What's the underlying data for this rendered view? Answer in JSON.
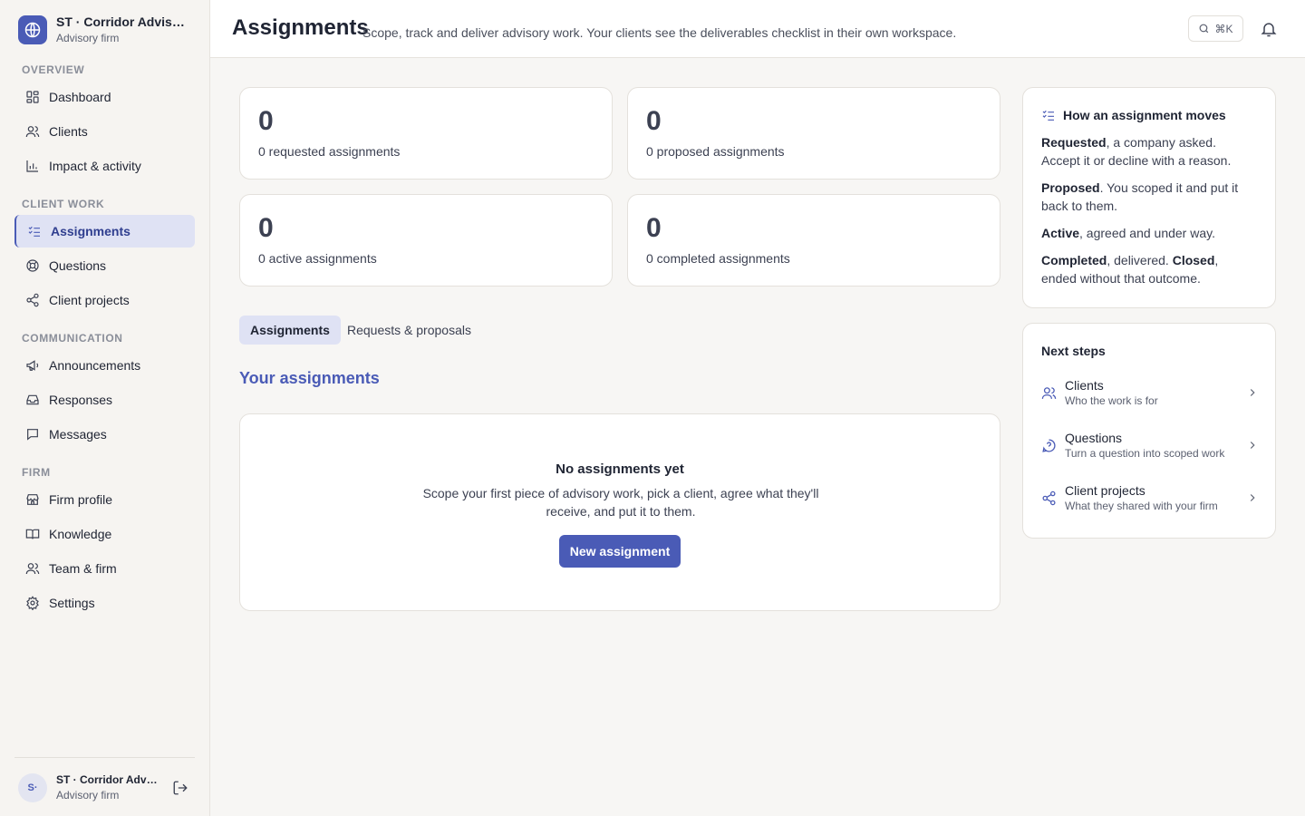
{
  "org": {
    "name": "ST · Corridor Advisory...",
    "type": "Advisory firm"
  },
  "sidebar": {
    "sections": [
      {
        "label": "OVERVIEW"
      },
      {
        "label": "CLIENT WORK"
      },
      {
        "label": "COMMUNICATION"
      },
      {
        "label": "FIRM"
      }
    ],
    "items": [
      {
        "label": "Dashboard",
        "icon": "grid-icon"
      },
      {
        "label": "Clients",
        "icon": "users-icon"
      },
      {
        "label": "Impact & activity",
        "icon": "bar-chart-icon"
      },
      {
        "label": "Assignments",
        "icon": "checklist-icon",
        "active": true
      },
      {
        "label": "Questions",
        "icon": "lifebuoy-icon"
      },
      {
        "label": "Client projects",
        "icon": "share-icon"
      },
      {
        "label": "Announcements",
        "icon": "megaphone-icon"
      },
      {
        "label": "Responses",
        "icon": "inbox-icon"
      },
      {
        "label": "Messages",
        "icon": "message-icon"
      },
      {
        "label": "Firm profile",
        "icon": "store-icon"
      },
      {
        "label": "Knowledge",
        "icon": "book-icon"
      },
      {
        "label": "Team & firm",
        "icon": "users-icon"
      },
      {
        "label": "Settings",
        "icon": "gear-icon"
      }
    ]
  },
  "user": {
    "initials": "S·",
    "name": "ST · Corridor Advis...",
    "role": "Advisory firm"
  },
  "header": {
    "title": "Assignments",
    "subtitle": "Scope, track and deliver advisory work. Your clients see the deliverables checklist in their own workspace.",
    "search_shortcut": "⌘K"
  },
  "stats": [
    {
      "value": "0",
      "label": "0 requested assignments"
    },
    {
      "value": "0",
      "label": "0 proposed assignments"
    },
    {
      "value": "0",
      "label": "0 active assignments"
    },
    {
      "value": "0",
      "label": "0 completed assignments"
    }
  ],
  "tabs": [
    {
      "label": "Assignments",
      "active": true
    },
    {
      "label": "Requests & proposals",
      "active": false
    }
  ],
  "section_title": "Your assignments",
  "empty": {
    "title": "No assignments yet",
    "description": "Scope your first piece of advisory work, pick a client, agree what they'll receive, and put it to them.",
    "button": "New assignment"
  },
  "how_panel": {
    "title": "How an assignment moves",
    "rules": [
      {
        "term": "Requested",
        "text": ", a company asked. Accept it or decline with a reason."
      },
      {
        "term": "Proposed",
        "text": ". You scoped it and put it back to them."
      },
      {
        "term": "Active",
        "text": ", agreed and under way."
      },
      {
        "term": "Completed",
        "text": ", delivered. ",
        "term2": "Closed",
        "text2": ", ended without that outcome."
      }
    ]
  },
  "next_steps": {
    "title": "Next steps",
    "items": [
      {
        "title": "Clients",
        "sub": "Who the work is for"
      },
      {
        "title": "Questions",
        "sub": "Turn a question into scoped work"
      },
      {
        "title": "Client projects",
        "sub": "What they shared with your firm"
      }
    ]
  },
  "colors": {
    "accent": "#4a5bb6",
    "active_bg": "#dfe2f4",
    "sidebar_bg": "#f6f4f1"
  }
}
